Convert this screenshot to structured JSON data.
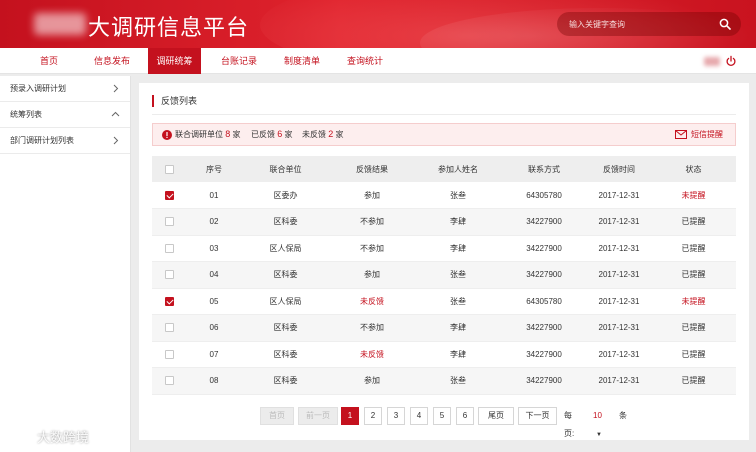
{
  "app": {
    "title": "大调研信息平台",
    "brand_color": "#c4111e"
  },
  "search": {
    "placeholder": "输入关键字查询",
    "icon": "search-icon"
  },
  "nav": {
    "items": [
      {
        "label": "首页",
        "active": false
      },
      {
        "label": "信息发布",
        "active": false
      },
      {
        "label": "调研统筹",
        "active": true
      },
      {
        "label": "台账记录",
        "active": false
      },
      {
        "label": "制度清单",
        "active": false
      },
      {
        "label": "查询统计",
        "active": false
      }
    ],
    "power_icon": "power-icon"
  },
  "sidebar": {
    "items": [
      {
        "label": "预录入调研计划",
        "chevron": "right"
      },
      {
        "label": "统筹列表",
        "chevron": "up"
      },
      {
        "label": "部门调研计划列表",
        "chevron": "right"
      }
    ]
  },
  "panel": {
    "title": "反馈列表",
    "summary": {
      "units_label": "联合调研单位",
      "units_count": "8",
      "units_unit": "家",
      "fed_label": "已反馈",
      "fed_count": "6",
      "fed_unit": "家",
      "unfed_label": "未反馈",
      "unfed_count": "2",
      "unfed_unit": "家",
      "sms_label": "短信提醒"
    }
  },
  "table": {
    "columns": [
      "序号",
      "联合单位",
      "反馈结果",
      "参加人姓名",
      "联系方式",
      "反馈时间",
      "状态"
    ],
    "rows": [
      {
        "checked": true,
        "no": "01",
        "unit": "区委办",
        "result": "参加",
        "result_red": false,
        "name": "张叁",
        "contact": "64305780",
        "time": "2017-12-31",
        "status": "未提醒",
        "status_red": true
      },
      {
        "checked": false,
        "no": "02",
        "unit": "区科委",
        "result": "不参加",
        "result_red": false,
        "name": "李肆",
        "contact": "34227900",
        "time": "2017-12-31",
        "status": "已提醒",
        "status_red": false
      },
      {
        "checked": false,
        "no": "03",
        "unit": "区人保局",
        "result": "不参加",
        "result_red": false,
        "name": "李肆",
        "contact": "34227900",
        "time": "2017-12-31",
        "status": "已提醒",
        "status_red": false
      },
      {
        "checked": false,
        "no": "04",
        "unit": "区科委",
        "result": "参加",
        "result_red": false,
        "name": "张叁",
        "contact": "34227900",
        "time": "2017-12-31",
        "status": "已提醒",
        "status_red": false
      },
      {
        "checked": true,
        "no": "05",
        "unit": "区人保局",
        "result": "未反馈",
        "result_red": true,
        "name": "张叁",
        "contact": "64305780",
        "time": "2017-12-31",
        "status": "未提醒",
        "status_red": true
      },
      {
        "checked": false,
        "no": "06",
        "unit": "区科委",
        "result": "不参加",
        "result_red": false,
        "name": "李肆",
        "contact": "34227900",
        "time": "2017-12-31",
        "status": "已提醒",
        "status_red": false
      },
      {
        "checked": false,
        "no": "07",
        "unit": "区科委",
        "result": "未反馈",
        "result_red": true,
        "name": "李肆",
        "contact": "34227900",
        "time": "2017-12-31",
        "status": "已提醒",
        "status_red": false
      },
      {
        "checked": false,
        "no": "08",
        "unit": "区科委",
        "result": "参加",
        "result_red": false,
        "name": "张叁",
        "contact": "34227900",
        "time": "2017-12-31",
        "status": "已提醒",
        "status_red": false
      }
    ]
  },
  "pagination": {
    "first": "首页",
    "prev": "前一页",
    "pages": [
      "1",
      "2",
      "3",
      "4",
      "5",
      "6"
    ],
    "current_page": "1",
    "last": "尾页",
    "next": "下一页",
    "per_page_label": "每页:",
    "per_page_value": "10",
    "per_page_unit": "条"
  },
  "watermark": {
    "text": "大数跨境"
  }
}
